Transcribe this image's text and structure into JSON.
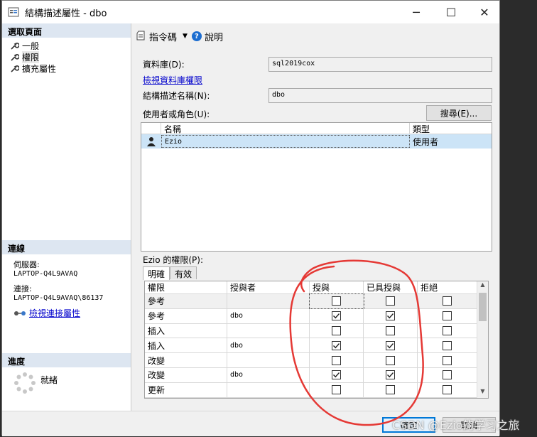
{
  "window": {
    "title": "結構描述屬性 - dbo",
    "controls": {
      "minimize": "─",
      "maximize": "☐",
      "close": "✕"
    }
  },
  "left_panel": {
    "select_page_header": "選取頁面",
    "pages": [
      {
        "label": "一般",
        "icon": "wrench-icon"
      },
      {
        "label": "權限",
        "icon": "wrench-icon"
      },
      {
        "label": "擴充屬性",
        "icon": "wrench-icon"
      }
    ],
    "connection": {
      "header": "連線",
      "server_label": "伺服器:",
      "server_value": "LAPTOP-Q4L9AVAQ",
      "connection_label": "連接:",
      "connection_value": "LAPTOP-Q4L9AVAQ\\86137",
      "view_link": "檢視連接屬性"
    },
    "progress": {
      "header": "進度",
      "status": "就緒"
    }
  },
  "toolbar": {
    "script_label": "指令碼",
    "help_label": "說明"
  },
  "form": {
    "database_label": "資料庫(D):",
    "database_value": "sql2019cox",
    "view_db_perms_link": "檢視資料庫權限",
    "schema_name_label": "結構描述名稱(N):",
    "schema_name_value": "dbo",
    "users_roles_label": "使用者或角色(U):",
    "search_button": "搜尋(E)..."
  },
  "users_grid": {
    "columns": [
      "名稱",
      "類型"
    ],
    "rows": [
      {
        "name": "Ezio",
        "type": "使用者"
      }
    ]
  },
  "permissions": {
    "label": "Ezio 的權限(P):",
    "tabs": [
      "明確",
      "有效"
    ],
    "columns": [
      "權限",
      "授與者",
      "授與",
      "已具授與",
      "拒絕"
    ],
    "rows": [
      {
        "permission": "參考",
        "grantor": "",
        "grant": false,
        "with_grant": false,
        "deny": false
      },
      {
        "permission": "參考",
        "grantor": "dbo",
        "grant": true,
        "with_grant": true,
        "deny": false
      },
      {
        "permission": "插入",
        "grantor": "",
        "grant": false,
        "with_grant": false,
        "deny": false
      },
      {
        "permission": "插入",
        "grantor": "dbo",
        "grant": true,
        "with_grant": true,
        "deny": false
      },
      {
        "permission": "改變",
        "grantor": "",
        "grant": false,
        "with_grant": false,
        "deny": false
      },
      {
        "permission": "改變",
        "grantor": "dbo",
        "grant": true,
        "with_grant": true,
        "deny": false
      },
      {
        "permission": "更新",
        "grantor": "",
        "grant": false,
        "with_grant": false,
        "deny": false
      }
    ]
  },
  "footer": {
    "ok_button": "確定",
    "cancel_button": "取消"
  },
  "watermark": "CSDN @Ezio的学习之旅",
  "colors": {
    "selection": "#cce4f7",
    "section_header": "#dde6f1",
    "link": "#0000cc",
    "annotation": "#e53935"
  }
}
